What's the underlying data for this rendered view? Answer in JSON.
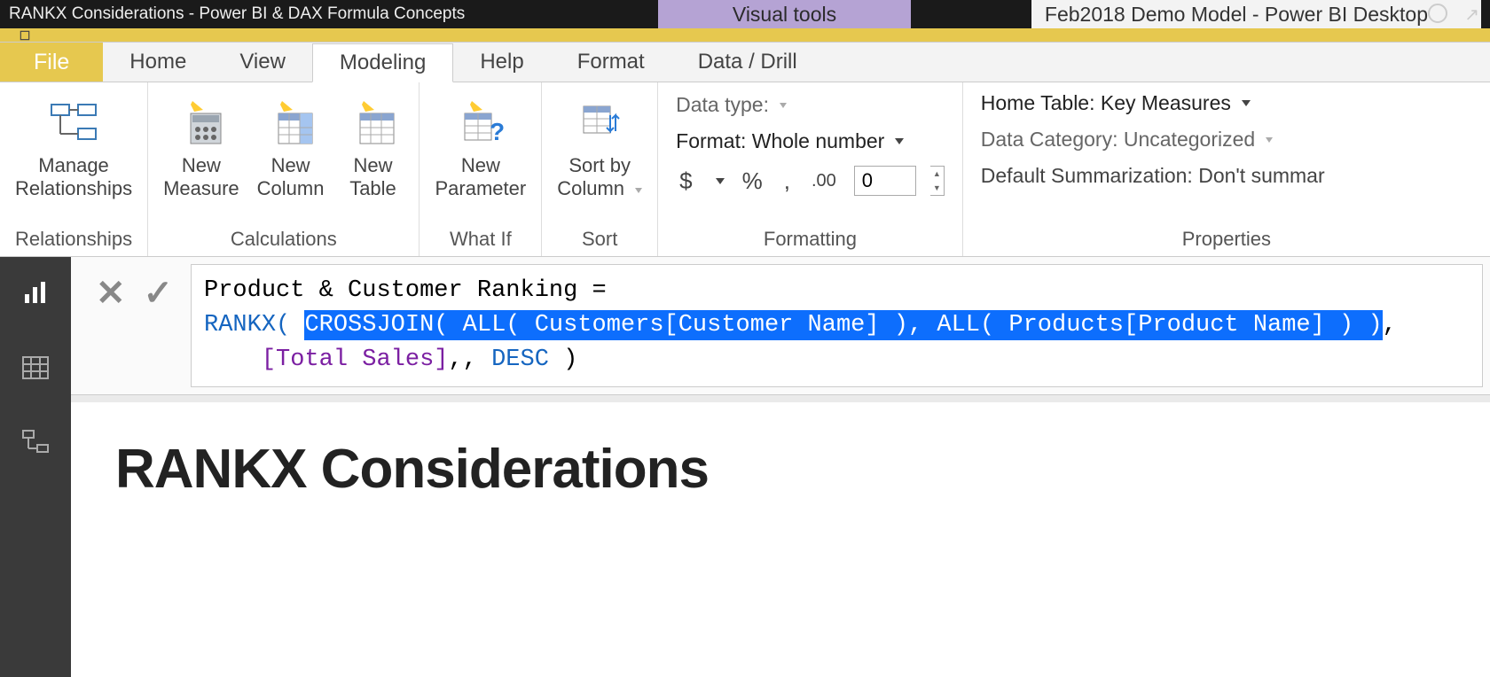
{
  "titlebar": {
    "video_title": "RANKX Considerations - Power BI & DAX Formula Concepts",
    "context_tab": "Visual tools",
    "window_title": "Feb2018 Demo Model - Power BI Desktop"
  },
  "ribbon": {
    "tabs": {
      "file": "File",
      "home": "Home",
      "view": "View",
      "modeling": "Modeling",
      "help": "Help",
      "format": "Format",
      "dataDrill": "Data / Drill"
    },
    "groups": {
      "relationships": {
        "label": "Relationships",
        "manage": "Manage\nRelationships"
      },
      "calculations": {
        "label": "Calculations",
        "newMeasure": "New\nMeasure",
        "newColumn": "New\nColumn",
        "newTable": "New\nTable"
      },
      "whatif": {
        "label": "What If",
        "newParameter": "New\nParameter"
      },
      "sort": {
        "label": "Sort",
        "sortBy": "Sort by\nColumn"
      },
      "formatting": {
        "label": "Formatting",
        "dataType": "Data type:",
        "format": "Format: Whole number",
        "currency": "$",
        "percent": "%",
        "comma": ",",
        "precision": ".00",
        "decimals": "0"
      },
      "properties": {
        "label": "Properties",
        "homeTable": "Home Table: Key Measures",
        "dataCategory": "Data Category: Uncategorized",
        "summarization": "Default Summarization: Don't summar"
      }
    }
  },
  "formula": {
    "line1_name": "Product & Customer Ranking = ",
    "line2_rankx": "RANKX( ",
    "line2_highlight": "CROSSJOIN( ALL( Customers[Customer Name] ), ALL( Products[Product Name] ) )",
    "line3_indent": "    ",
    "line3_measure": "[Total Sales]",
    "line3_rest": ",, ",
    "line3_desc": "DESC",
    "line3_close": " )"
  },
  "canvas": {
    "heading": "RANKX Considerations"
  }
}
